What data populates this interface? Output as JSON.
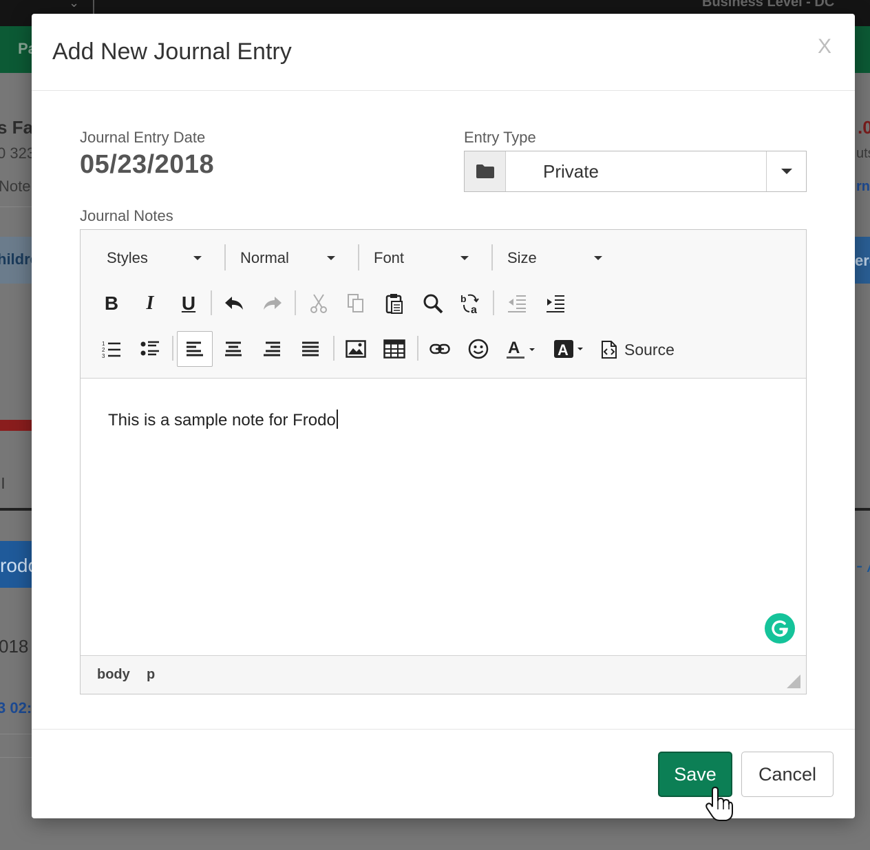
{
  "background": {
    "business_level": "Business Level - DC",
    "nav_label": "Pa",
    "family_name": "s Fa",
    "phone_partial": "0 323",
    "notes_partial": "Note",
    "children_partial": "hildre",
    "emergency_partial": "erg",
    "amount_partial": ".0",
    "outs_partial": "uts",
    "journal_partial": "rn",
    "child_name_partial": "rodo",
    "tab_partial": "- A",
    "bar_partial": "l",
    "year_partial": "018",
    "time_partial": "3 02:"
  },
  "modal": {
    "title": "Add New Journal Entry",
    "close_label": "X",
    "date_label": "Journal Entry Date",
    "date_value": "05/23/2018",
    "entry_type_label": "Entry Type",
    "entry_type_value": "Private",
    "notes_label": "Journal Notes",
    "save_label": "Save",
    "cancel_label": "Cancel"
  },
  "editor": {
    "styles_label": "Styles",
    "format_label": "Normal",
    "font_label": "Font",
    "size_label": "Size",
    "source_label": "Source",
    "content": "This is a sample note for Frodo",
    "path": [
      "body",
      "p"
    ]
  },
  "colors": {
    "primary": "#0c7f55",
    "grammarly": "#15c39a",
    "nav_green": "#0c5a35"
  }
}
